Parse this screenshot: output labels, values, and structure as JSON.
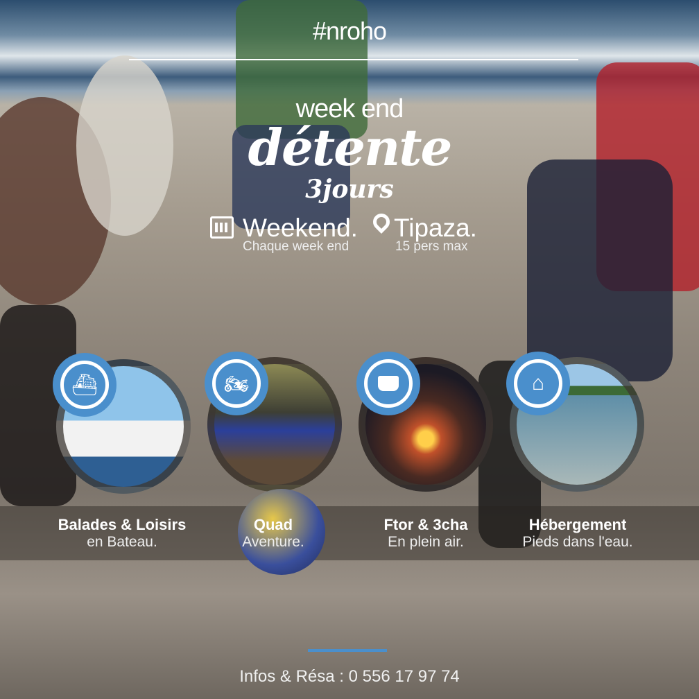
{
  "header": {
    "hashtag": "#nroho",
    "subtitle": "week end",
    "title": "détente",
    "duration": "3jours"
  },
  "info": [
    {
      "icon": "calendar-icon",
      "label": "Weekend.",
      "sub": "Chaque week end"
    },
    {
      "icon": "location-pin-icon",
      "label": "Tipaza.",
      "sub": "15 pers max"
    }
  ],
  "activities": [
    {
      "icon": "boat-icon",
      "title": "Balades & Loisirs",
      "sub": "en Bateau."
    },
    {
      "icon": "quad-icon",
      "title": "Quad",
      "sub": "Aventure."
    },
    {
      "icon": "cooking-pot-icon",
      "title": "Ftor & 3cha",
      "sub": "En plein air."
    },
    {
      "icon": "house-icon",
      "title": "Hébergement",
      "sub": "Pieds dans l'eau."
    }
  ],
  "footer": {
    "contact": "Infos & Résa : 0 556 17 97 74"
  },
  "colors": {
    "accent": "#4a8fcc"
  }
}
